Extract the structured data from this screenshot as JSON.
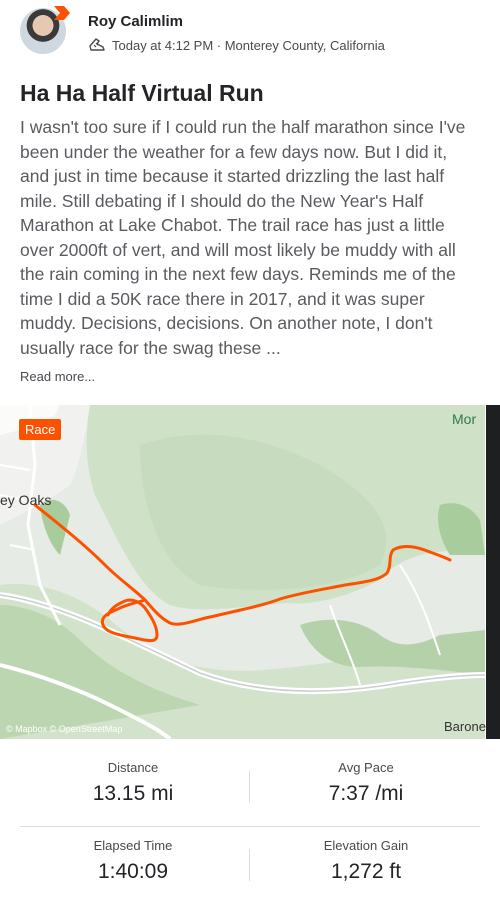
{
  "activity": {
    "author": "Roy Calimlim",
    "meta": "Today at 4:12 PM · Monterey County, California",
    "title": "Ha Ha Half Virtual Run",
    "description": "I wasn't too sure if I could run the half marathon since I've been under the weather for a few days now. But I did it, and just in time because it started drizzling the last half mile. Still debating if I should do the New Year's Half Marathon at Lake Chabot. The trail race has just a little over 2000ft of vert, and will most likely be muddy with all the rain coming in the next few days. Reminds me of the time I did a 50K race there in 2017, and it was super muddy. Decisions, decisions. On another note, I don't usually race for the swag these ...",
    "read_more": "Read more..."
  },
  "map": {
    "badge": "Race",
    "labels": {
      "left": "ey Oaks",
      "top_right": "Mor",
      "bottom_right": "Barone"
    },
    "attribution": "© Mapbox © OpenStreetMap",
    "route_color": "#fc5200",
    "accent": "#fc5200"
  },
  "stats": [
    {
      "label": "Distance",
      "value": "13.15 mi"
    },
    {
      "label": "Avg Pace",
      "value": "7:37 /mi"
    },
    {
      "label": "Elapsed Time",
      "value": "1:40:09"
    },
    {
      "label": "Elevation Gain",
      "value": "1,272 ft"
    }
  ]
}
